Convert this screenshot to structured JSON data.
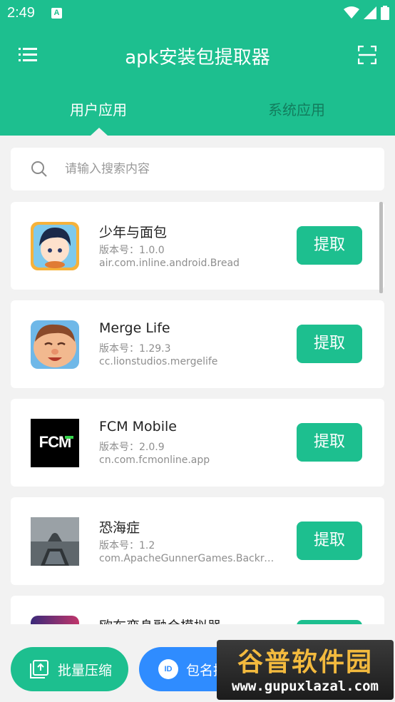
{
  "status_bar": {
    "time": "2:49",
    "notif_glyph": "A"
  },
  "header": {
    "title": "apk安装包提取器",
    "menu_icon": "menu-icon",
    "scan_icon": "scan-icon"
  },
  "tabs": [
    {
      "label": "用户应用",
      "active": true
    },
    {
      "label": "系统应用",
      "active": false
    }
  ],
  "search": {
    "placeholder": "请输入搜索内容",
    "value": ""
  },
  "apps": [
    {
      "name": "少年与面包",
      "version": "版本号：1.0.0",
      "package": "air.com.inline.android.Bread",
      "button": "提取"
    },
    {
      "name": "Merge Life",
      "version": "版本号：1.29.3",
      "package": "cc.lionstudios.mergelife",
      "button": "提取"
    },
    {
      "name": "FCM Mobile",
      "version": "版本号：2.0.9",
      "package": "cn.com.fcmonline.app",
      "button": "提取",
      "icon_text": "FCM"
    },
    {
      "name": "恐海症",
      "version": "版本号：1.2",
      "package": "com.ApacheGunnerGames.Backro...",
      "button": "提取"
    },
    {
      "name": "欧布变身融合模拟器",
      "version": "",
      "package": "",
      "button": "提取"
    }
  ],
  "bottom": {
    "bulk_label": "批量压缩",
    "pkg_label": "包名提取",
    "pkg_icon_text": "ID"
  },
  "watermark": {
    "main": "谷普软件园",
    "url": "www.gupuxlazal.com"
  },
  "colors": {
    "primary": "#1dbf8f",
    "blue": "#2f8cff",
    "background": "#f2f2f2"
  }
}
